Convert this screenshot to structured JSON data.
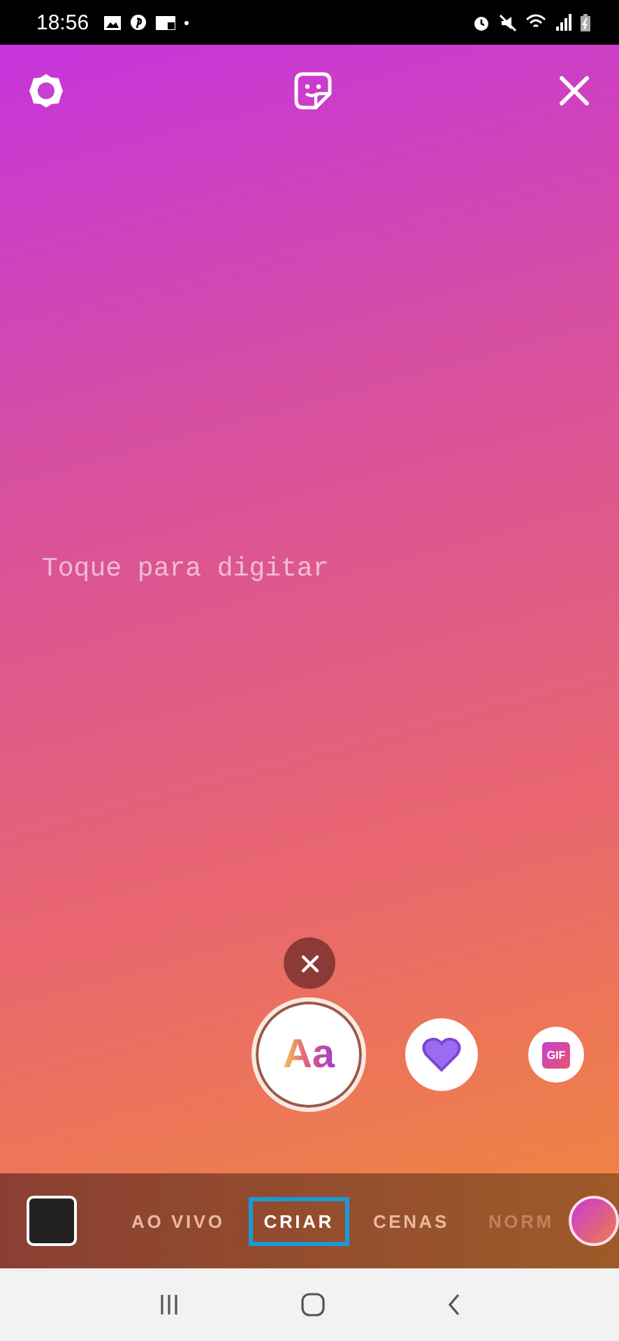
{
  "status_bar": {
    "time": "18:56"
  },
  "canvas": {
    "placeholder": "Toque para digitar"
  },
  "tools": {
    "text_button": "Aa",
    "gif_label": "GIF"
  },
  "modes": [
    {
      "label": "AO VIVO",
      "selected": false,
      "faded": false
    },
    {
      "label": "CRIAR",
      "selected": true,
      "faded": false
    },
    {
      "label": "CENAS",
      "selected": false,
      "faded": false
    },
    {
      "label": "NORM",
      "selected": false,
      "faded": true
    }
  ]
}
